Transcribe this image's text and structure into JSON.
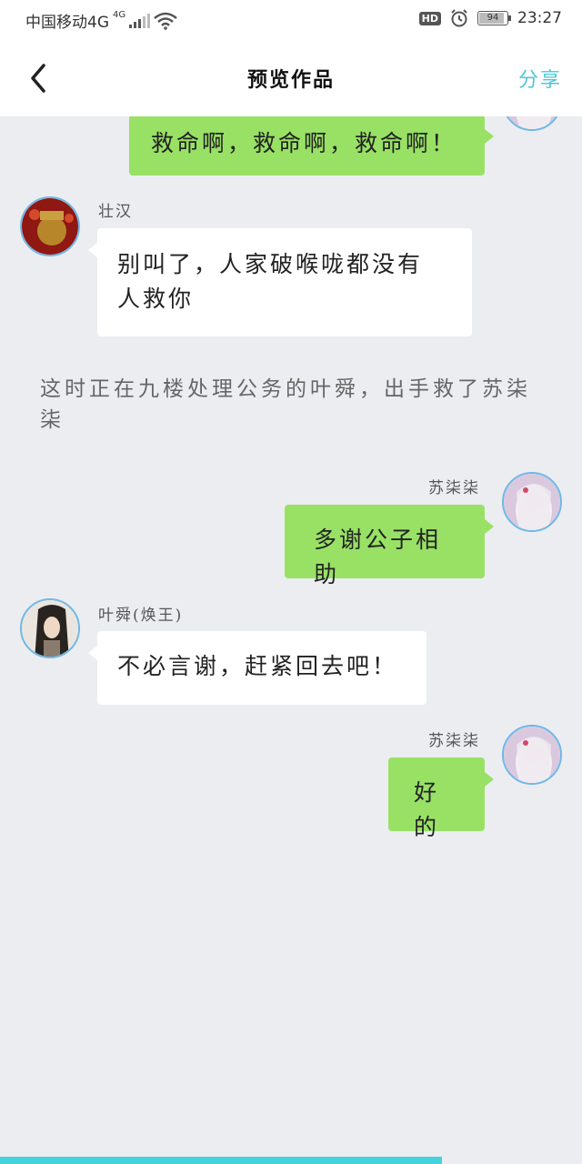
{
  "status_bar": {
    "carrier": "中国移动4G",
    "network": "4G",
    "hd": "HD",
    "battery": "94",
    "battery_level": 0.94,
    "time": "23:27"
  },
  "header": {
    "title": "预览作品",
    "share_label": "分享"
  },
  "messages": [
    {
      "side": "right",
      "name": "",
      "text": "救命啊，救命啊，救命啊！"
    },
    {
      "side": "left",
      "name": "壮汉",
      "text_line1": "别叫了，人家破喉咙都没有",
      "text_line2": "人救你"
    },
    {
      "side": "narration",
      "text_line1": "这时正在九楼处理公务的叶舜，出手救了苏柒",
      "text_line2": "柒"
    },
    {
      "side": "right",
      "name": "苏柒柒",
      "text": "多谢公子相助"
    },
    {
      "side": "left",
      "name": "叶舜(焕王)",
      "text": "不必言谢，赶紧回去吧！"
    },
    {
      "side": "right",
      "name": "苏柒柒",
      "text": "好的"
    }
  ],
  "progress": {
    "value": 0.76
  },
  "colors": {
    "accent": "#45d3db",
    "share": "#4fc6d8",
    "bubble_green": "#98e165",
    "background": "#ebedf1"
  },
  "icons": [
    "back-arrow-icon",
    "signal-icon",
    "wifi-icon",
    "alarm-icon",
    "battery-icon"
  ]
}
